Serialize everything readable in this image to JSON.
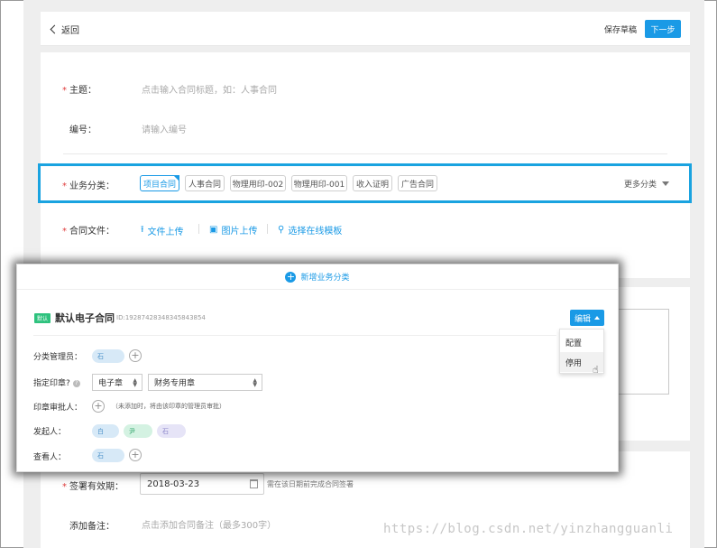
{
  "header": {
    "back_label": "返回",
    "save_draft_label": "保存草稿",
    "next_label": "下一步"
  },
  "form": {
    "subject": {
      "label": "主题：",
      "placeholder": "点击输入合同标题，如：人事合同"
    },
    "number": {
      "label": "编号：",
      "placeholder": "请输入编号"
    },
    "business_category": {
      "label": "业务分类：",
      "tags": [
        "项目合同",
        "人事合同",
        "物理用印-002",
        "物理用印-001",
        "收入证明",
        "广告合同"
      ],
      "more_label": "更多分类"
    },
    "contract_file": {
      "label": "合同文件：",
      "actions": [
        "文件上传",
        "图片上传",
        "选择在线模板"
      ]
    },
    "validity": {
      "label": "签署有效期：",
      "value": "2018-03-23",
      "hint": "需在该日期前完成合同签署"
    },
    "remark": {
      "label": "添加备注：",
      "placeholder": "点击添加合同备注（最多300字）"
    }
  },
  "popup": {
    "add_category_label": "新增业务分类",
    "default_badge": "默认",
    "category_title": "默认电子合同",
    "category_id": "ID:19287428348345843854",
    "edit_label": "编辑",
    "menu_items": [
      "配置",
      "停用"
    ],
    "fields": {
      "manager_label": "分类管理员：",
      "manager_pill": "石",
      "seal_label": "指定印章?",
      "seal_type": "电子章",
      "seal_name": "财务专用章",
      "approver_label": "印章审批人：",
      "approver_note": "（未添加时，将由该印章的管理员审批）",
      "initiator_label": "发起人：",
      "initiators": [
        "白",
        "尹",
        "石"
      ],
      "viewer_label": "查看人：",
      "viewer_pill": "石"
    }
  },
  "watermark": "https://blog.csdn.net/yinzhangguanli",
  "colors": {
    "primary": "#1a9ae6",
    "highlight_border": "#1aa3e0",
    "required": "#e04040",
    "default_badge": "#2ec27e"
  }
}
